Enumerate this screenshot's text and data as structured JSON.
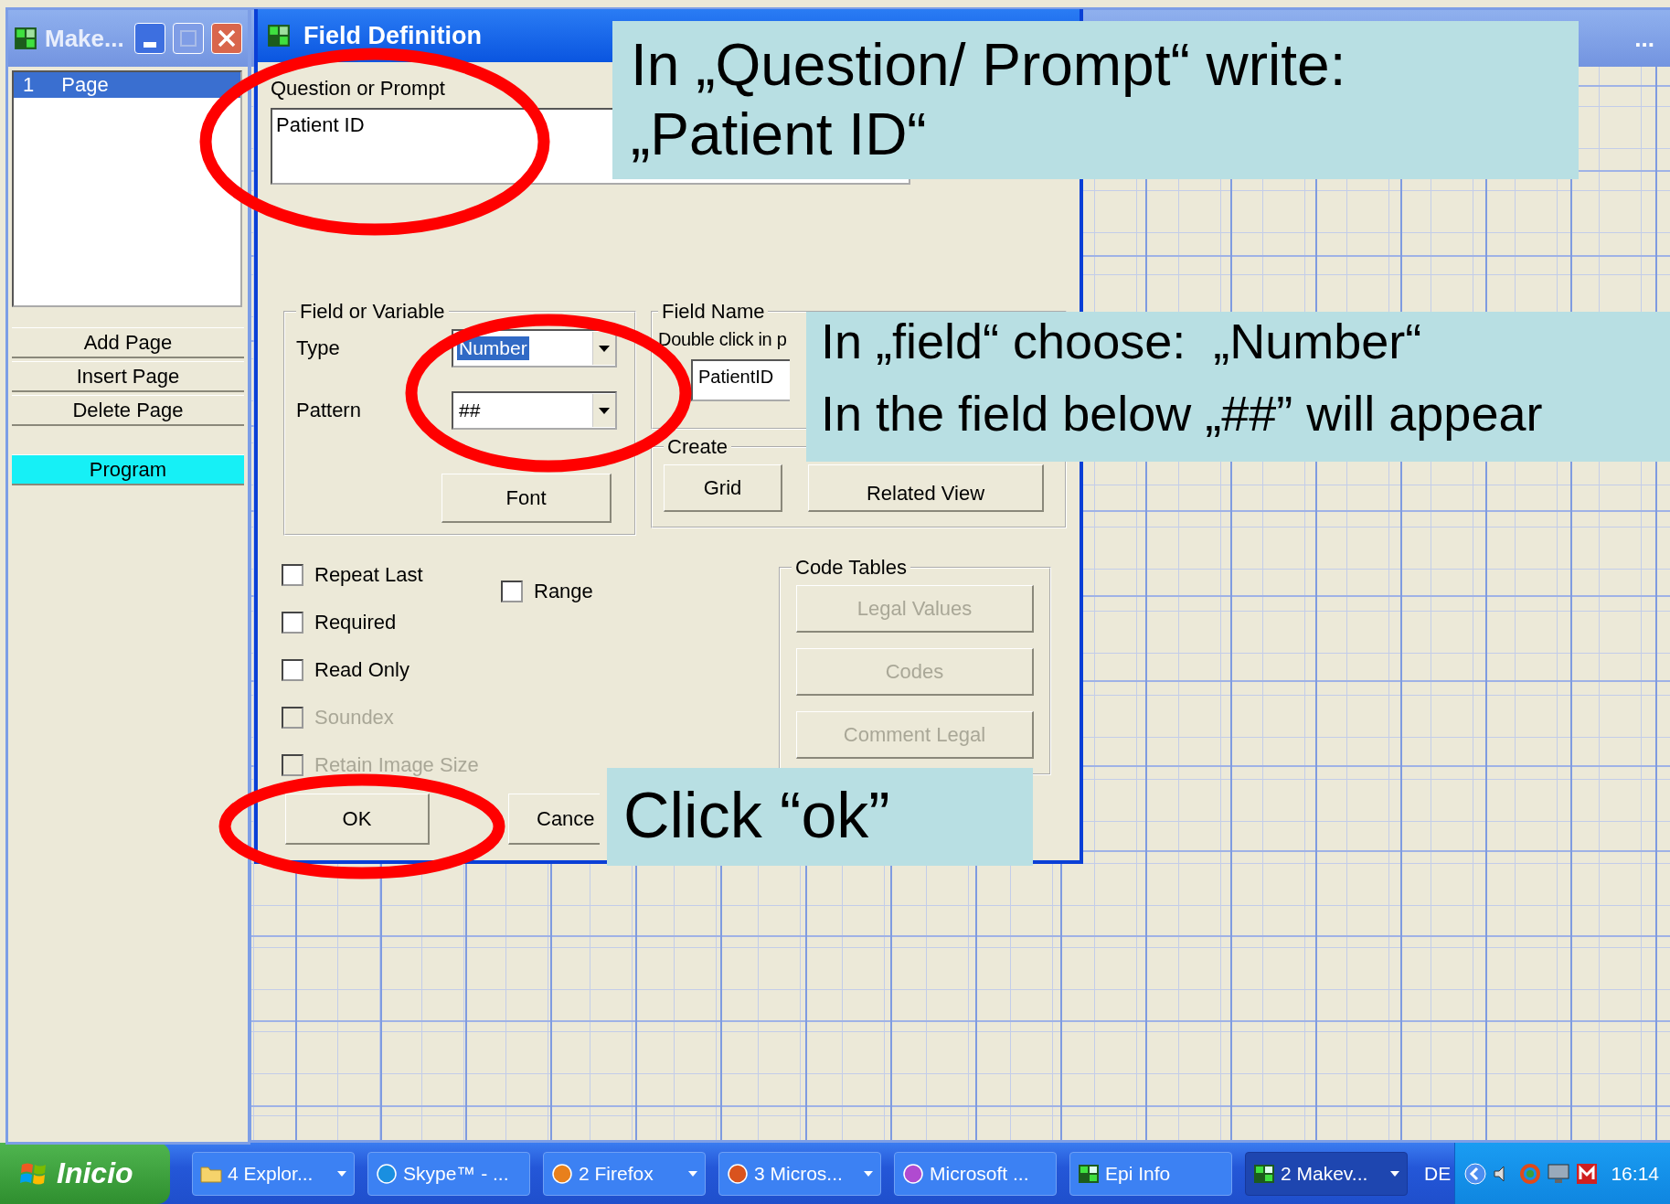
{
  "background_window": {
    "title": "..."
  },
  "main_window": {
    "title": "Make...",
    "pages": [
      {
        "number": "1",
        "label": "Page",
        "selected": true
      }
    ],
    "buttons": [
      {
        "label": "Add Page",
        "highlighted": false
      },
      {
        "label": "Insert Page",
        "highlighted": false
      },
      {
        "label": "Delete Page",
        "highlighted": false
      },
      {
        "label": "Program",
        "highlighted": true
      }
    ]
  },
  "dialog": {
    "title": "Field Definition",
    "prompt_label": "Question or Prompt",
    "prompt_value": "Patient ID",
    "field_group": {
      "legend": "Field or Variable",
      "type_label": "Type",
      "type_value": "Number",
      "type_value_selected": true,
      "pattern_label": "Pattern",
      "pattern_value": "##",
      "font_button": "Font"
    },
    "field_name_group": {
      "legend": "Field Name",
      "hint": "Double click in p",
      "value": "PatientID"
    },
    "create_group": {
      "legend": "Create",
      "buttons": [
        "Grid",
        "Related View"
      ]
    },
    "checkboxes": [
      {
        "label": "Repeat Last",
        "checked": false,
        "disabled": false
      },
      {
        "label": "Required",
        "checked": false,
        "disabled": false
      },
      {
        "label": "Read Only",
        "checked": false,
        "disabled": false
      },
      {
        "label": "Soundex",
        "checked": false,
        "disabled": true
      },
      {
        "label": "Retain Image Size",
        "checked": false,
        "disabled": true
      }
    ],
    "range": {
      "label": "Range",
      "checked": false
    },
    "code_tables": {
      "legend": "Code Tables",
      "buttons": [
        {
          "label": "Legal Values",
          "disabled": true
        },
        {
          "label": "Codes",
          "disabled": true
        },
        {
          "label": "Comment Legal",
          "disabled": true
        }
      ]
    },
    "buttons": [
      "OK",
      "Cance"
    ]
  },
  "annotations": [
    {
      "lines": [
        "In „Question/ Prompt“ write:",
        "„Patient ID“"
      ]
    },
    {
      "lines": [
        "In „field“ choose:  „Number“",
        "In the field below „##” will appear"
      ]
    },
    {
      "lines": [
        "Click “ok”"
      ]
    }
  ],
  "taskbar": {
    "start": "Inicio",
    "tasks": [
      {
        "label": "4 Explor...",
        "kind": "folder",
        "grouped": true,
        "selected": false
      },
      {
        "label": "Skype™ - ...",
        "kind": "chat",
        "grouped": false,
        "selected": false
      },
      {
        "label": "2 Firefox",
        "kind": "browser",
        "grouped": true,
        "selected": false
      },
      {
        "label": "3 Micros...",
        "kind": "slides",
        "grouped": true,
        "selected": false
      },
      {
        "label": "Microsoft ...",
        "kind": "editor",
        "grouped": false,
        "selected": false
      },
      {
        "label": "Epi Info",
        "kind": "epi",
        "grouped": false,
        "selected": false
      },
      {
        "label": "2 Makev...",
        "kind": "epi",
        "grouped": true,
        "selected": true
      }
    ],
    "language": "DE",
    "clock": "16:14"
  }
}
